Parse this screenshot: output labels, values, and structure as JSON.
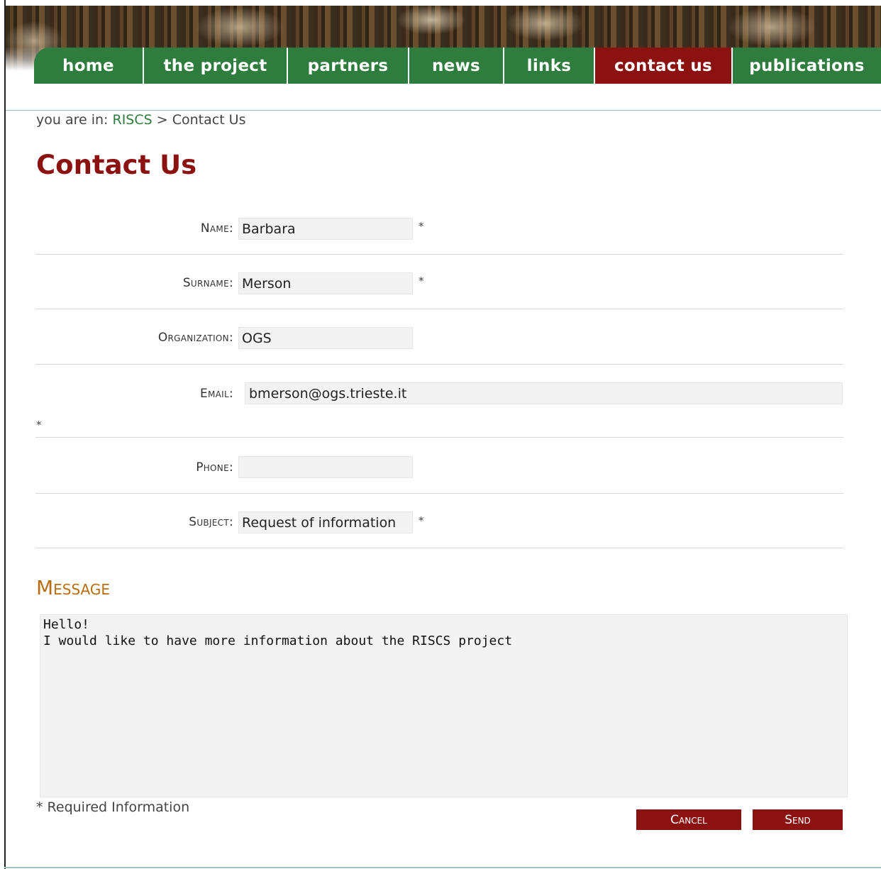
{
  "nav": {
    "items": [
      {
        "label": "home"
      },
      {
        "label": "the project"
      },
      {
        "label": "partners"
      },
      {
        "label": "news"
      },
      {
        "label": "links"
      },
      {
        "label": "contact us"
      },
      {
        "label": "publications"
      }
    ],
    "active_item": "contact us",
    "color_default": "#2e7d3e",
    "color_active": "#8c1212"
  },
  "breadcrumb": {
    "prefix": "you are in:",
    "root": "RISCS",
    "separator": ">",
    "current": "Contact Us"
  },
  "page": {
    "title": "Contact Us"
  },
  "form": {
    "name": {
      "label": "Name:",
      "value": "Barbara",
      "required_mark": "*"
    },
    "surname": {
      "label": "Surname:",
      "value": "Merson",
      "required_mark": "*"
    },
    "organization": {
      "label": "Organization:",
      "value": "OGS"
    },
    "email": {
      "label": "Email:",
      "value": "bmerson@ogs.trieste.it",
      "required_mark": "*"
    },
    "phone": {
      "label": "Phone:",
      "value": ""
    },
    "subject": {
      "label": "Subject:",
      "value": "Request of information",
      "required_mark": "*"
    },
    "message": {
      "heading": "Message",
      "value": "Hello!\nI would like to have more information about the RISCS project"
    },
    "required_note": "* Required Information",
    "cancel_label": "Cancel",
    "send_label": "Send"
  }
}
